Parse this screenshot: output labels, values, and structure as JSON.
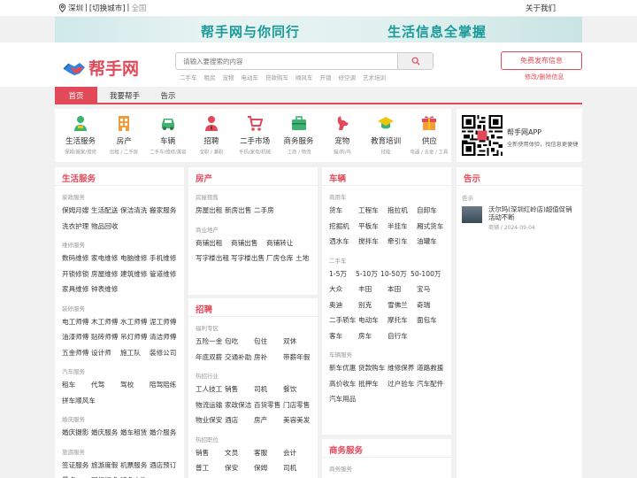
{
  "topbar": {
    "city": "深圳",
    "switch_label": "[切换城市]",
    "all_label": "全国",
    "about_label": "关于我们"
  },
  "banner": {
    "slogan_left": "帮手网与你同行",
    "slogan_right": "生活信息全掌握"
  },
  "header": {
    "logo_text": "帮手网",
    "search_placeholder": "请输入要搜索的内容",
    "hotwords": [
      "二手车",
      "租房",
      "宠物",
      "电动车",
      "贷款购车",
      "顺风车",
      "开锁",
      "修空调",
      "艺术培训"
    ],
    "publish_label": "免费发布信息",
    "modify_label": "修改/删除信息"
  },
  "nav": {
    "tabs": [
      "首页",
      "我要帮手",
      "告示"
    ]
  },
  "categories": [
    {
      "name": "生活服务",
      "sub": "保姆/搬家/维修",
      "icon": "person-service-icon"
    },
    {
      "name": "房产",
      "sub": "出租 / 二手房",
      "icon": "building-icon"
    },
    {
      "name": "车辆",
      "sub": "二手车/维修/美容",
      "icon": "car-icon"
    },
    {
      "name": "招聘",
      "sub": "全职 / 兼职",
      "icon": "recruit-person-icon"
    },
    {
      "name": "二手市场",
      "sub": "手机/家电/机械",
      "icon": "shopping-cart-icon"
    },
    {
      "name": "商务服务",
      "sub": "工商 / 物流",
      "icon": "briefcase-icon"
    },
    {
      "name": "宠物",
      "sub": "猫/狗/鸟",
      "icon": "dog-icon"
    },
    {
      "name": "教育培训",
      "sub": "技能",
      "icon": "graduation-cap-icon"
    },
    {
      "name": "供应",
      "sub": "电器 / 五金 / 工具",
      "icon": "gift-box-icon"
    }
  ],
  "app": {
    "title": "帮手网APP",
    "subtitle": "全新使用体验，找信息更便捷"
  },
  "life_service": {
    "title": "生活服务",
    "sections": [
      {
        "label": "家政服务",
        "rows": [
          [
            "保姆月嫂",
            "生活配送",
            "保洁清洗",
            "搬家服务"
          ],
          [
            "洗衣护理",
            "物品回收"
          ]
        ]
      },
      {
        "label": "维修服务",
        "rows": [
          [
            "数码维修",
            "家电维修",
            "电脑维修",
            "手机维修"
          ],
          [
            "开锁修锁",
            "房屋维修",
            "建筑维修",
            "管道维修"
          ],
          [
            "家具维修",
            "钟表维修"
          ]
        ]
      },
      {
        "label": "装修服务",
        "rows": [
          [
            "电工师傅",
            "木工师傅",
            "水工师傅",
            "泥工师傅"
          ],
          [
            "油漆师傅",
            "贴砖师傅",
            "吊灯师傅",
            "清洁师傅"
          ],
          [
            "五金师傅",
            "设计师",
            "施工队",
            "装修公司"
          ]
        ]
      },
      {
        "label": "汽车服务",
        "rows": [
          [
            "租车",
            "代驾",
            "驾校",
            "陪驾陪练"
          ],
          [
            "拼车顺风车"
          ]
        ]
      },
      {
        "label": "婚庆服务",
        "rows": [
          [
            "婚庆摄影",
            "婚庆服务",
            "婚车租赁",
            "婚介服务"
          ]
        ]
      },
      {
        "label": "旅游服务",
        "rows": [
          [
            "签证服务",
            "旅游度假",
            "机票服务",
            "酒店预订"
          ],
          [
            "景点",
            "网红打卡",
            "特色小吃"
          ]
        ]
      }
    ]
  },
  "house": {
    "title": "房产",
    "sections": [
      {
        "label": "房屋租售",
        "rows": [
          [
            "房屋出租",
            "新房出售",
            "二手房"
          ]
        ]
      },
      {
        "label": "商业地产",
        "rows": [
          [
            "商铺出租",
            "商铺出售",
            "商铺转让"
          ],
          [
            "写字楼出租",
            "写字楼出售",
            "厂房仓库",
            "土地"
          ]
        ]
      }
    ]
  },
  "recruit": {
    "title": "招聘",
    "sections": [
      {
        "label": "福利专区",
        "rows": [
          [
            "五险一金",
            "包吃",
            "包住",
            "双休"
          ],
          [
            "年底双薪",
            "交通补助",
            "房补",
            "带薪年假"
          ]
        ]
      },
      {
        "label": "热招行业",
        "rows": [
          [
            "工人技工",
            "销售",
            "司机",
            "餐饮"
          ],
          [
            "物流运输",
            "家政保洁",
            "百货零售",
            "门店零售"
          ],
          [
            "物业保安",
            "酒店",
            "房产",
            "美容美发"
          ]
        ]
      },
      {
        "label": "热招职位",
        "rows": [
          [
            "销售",
            "文员",
            "客服",
            "会计"
          ],
          [
            "普工",
            "保安",
            "保姆",
            "司机"
          ]
        ]
      }
    ]
  },
  "car": {
    "title": "车辆",
    "sections": [
      {
        "label": "商用车",
        "rows": [
          [
            "货车",
            "工程车",
            "拖拉机",
            "自卸车"
          ],
          [
            "挖掘机",
            "平板车",
            "半挂车",
            "厢式货车"
          ],
          [
            "洒水车",
            "搅拌车",
            "牵引车",
            "油罐车"
          ]
        ]
      },
      {
        "label": "二手车",
        "rows": [
          [
            "1-5万",
            "5-10万",
            "10-50万",
            "50-100万"
          ],
          [
            "大众",
            "丰田",
            "本田",
            "宝马"
          ],
          [
            "奥迪",
            "别克",
            "雪佛兰",
            "奇瑞"
          ],
          [
            "二手轿车",
            "电动车",
            "摩托车",
            "面包车"
          ],
          [
            "客车",
            "房车",
            "自行车"
          ]
        ]
      },
      {
        "label": "车辆服务",
        "rows": [
          [
            "新车优惠",
            "贷款购车",
            "维修保养",
            "道路救援"
          ],
          [
            "高价收车",
            "抵押车",
            "过户验车",
            "汽车配件"
          ],
          [
            "汽车用品"
          ]
        ]
      }
    ]
  },
  "business": {
    "title": "商务服务",
    "sections": [
      {
        "label": "商务服务",
        "rows": []
      }
    ]
  },
  "notice": {
    "title": "告示",
    "section_label": "告示",
    "items": [
      {
        "title": "沃尔玛(深圳红岭店)超值促销活动不断",
        "meta": "商铺 / 2024-09-04"
      }
    ]
  },
  "colors": {
    "accent": "#e24a5a",
    "teal": "#1a9a9a"
  }
}
